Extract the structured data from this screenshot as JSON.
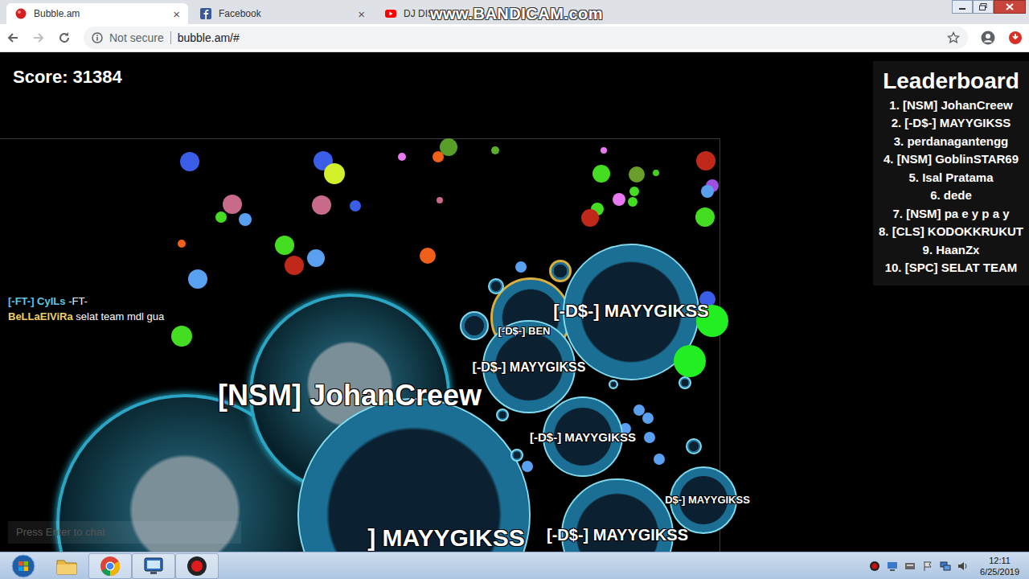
{
  "tabs": [
    {
      "label": "Bubble.am",
      "selected": true,
      "close": "×"
    },
    {
      "label": "Facebook",
      "selected": false,
      "close": "×"
    },
    {
      "label": "DJ DIS",
      "selected": false
    }
  ],
  "watermark": "www.BANDICAM.com",
  "address": {
    "security": "Not secure",
    "url": "bubble.am/#"
  },
  "game": {
    "score": "Score: 31384",
    "leaderboard": {
      "title": "Leaderboard",
      "entries": [
        "1. [NSM] JohanCreew",
        "2. [-D$-] MAYYGIKSS",
        "3. perdanagantengg",
        "4. [NSM] GoblinSTAR69",
        "5. Isal Pratama",
        "6. dede",
        "7. [NSM] pa e y p a y",
        "8. [CLS] KODOKKRUKUT",
        "9. HaanZx",
        "10. [SPC] SELAT TEAM"
      ]
    },
    "chat": [
      {
        "name": "[-FT-] CyILs",
        "message": "-FT-",
        "color": "#5bc8e8"
      },
      {
        "name": "BeLLaElViRa",
        "message": "selat team mdl gua",
        "color": "#f0d060"
      }
    ],
    "chat_input": {
      "placeholder": "Press Enter to chat"
    },
    "cells": [
      {
        "kind": "photo"
      },
      {
        "name": "[NSM] JohanCreew",
        "kind": "photo"
      },
      {
        "name": "] MAYYGIKSS",
        "kind": "ds"
      },
      {
        "name": "[-D$-] BEN",
        "kind": "gold"
      },
      {
        "kind": "ds"
      },
      {
        "kind": "ds"
      },
      {
        "kind": "gold"
      },
      {
        "name": "[-D$-] MAYYGIKSS",
        "kind": "ds"
      },
      {
        "name": "[-D$-] MAYYGIKSS",
        "kind": "ds"
      },
      {
        "name": "[-D$-] MAYYGIKSS",
        "kind": "ds"
      },
      {
        "name": "[-D$-] MAYYGIKSS",
        "kind": "ds"
      },
      {
        "name": "D$-] MAYYGIKSS",
        "kind": "ds"
      },
      {
        "kind": "ds"
      },
      {
        "kind": "ds"
      },
      {
        "kind": "ds"
      },
      {
        "kind": "ds"
      },
      {
        "kind": "ds"
      },
      {
        "kind": "plain",
        "color": "#22ee22"
      },
      {
        "kind": "plain",
        "color": "#22ee22"
      }
    ],
    "food": [
      {
        "color": "#3b5ee8"
      },
      {
        "color": "#3b5ee8"
      },
      {
        "color": "#d4f02a"
      },
      {
        "color": "#e879f0"
      },
      {
        "color": "#5a9e2a"
      },
      {
        "color": "#f0601a"
      },
      {
        "color": "#5ab02a"
      },
      {
        "color": "#e879f0"
      },
      {
        "color": "#c0281a"
      },
      {
        "color": "#44dd22"
      },
      {
        "color": "#6a9e2a"
      },
      {
        "color": "#44cc22"
      },
      {
        "color": "#a050e0"
      },
      {
        "color": "#5aa0f0"
      },
      {
        "color": "#c86a8a"
      },
      {
        "color": "#c86a8a"
      },
      {
        "color": "#3b5ee8"
      },
      {
        "color": "#c86a8a"
      },
      {
        "color": "#44dd22"
      },
      {
        "color": "#5aa0f0"
      },
      {
        "color": "#44dd22"
      },
      {
        "color": "#e879f0"
      },
      {
        "color": "#44dd22"
      },
      {
        "color": "#44dd22"
      },
      {
        "color": "#c0281a"
      },
      {
        "color": "#44dd22"
      },
      {
        "color": "#f0601a"
      },
      {
        "color": "#44dd22"
      },
      {
        "color": "#c0281a"
      },
      {
        "color": "#5aa0f0"
      },
      {
        "color": "#f0601a"
      },
      {
        "color": "#5aa0f0"
      },
      {
        "color": "#5aa0f0"
      },
      {
        "color": "#44dd22"
      },
      {
        "color": "#3b5ee8"
      },
      {
        "color": "#5aa0f0"
      },
      {
        "color": "#5aa0f0"
      },
      {
        "color": "#5aa0f0"
      },
      {
        "color": "#5aa0f0"
      },
      {
        "color": "#5aa0f0"
      },
      {
        "color": "#5aa0f0"
      },
      {
        "color": "#5ab0c0"
      }
    ]
  },
  "taskbar": {
    "time": "12:11",
    "date": "6/25/2019"
  }
}
